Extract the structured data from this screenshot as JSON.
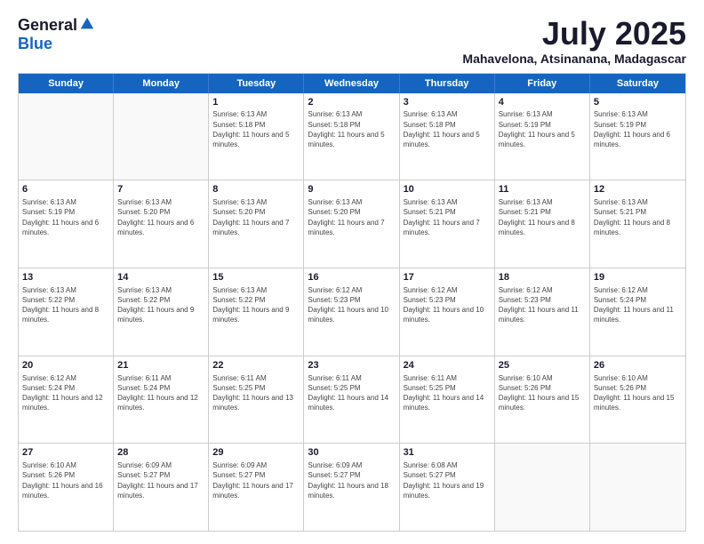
{
  "logo": {
    "general": "General",
    "blue": "Blue"
  },
  "title": "July 2025",
  "subtitle": "Mahavelona, Atsinanana, Madagascar",
  "headers": [
    "Sunday",
    "Monday",
    "Tuesday",
    "Wednesday",
    "Thursday",
    "Friday",
    "Saturday"
  ],
  "weeks": [
    [
      {
        "day": "",
        "info": ""
      },
      {
        "day": "",
        "info": ""
      },
      {
        "day": "1",
        "info": "Sunrise: 6:13 AM\nSunset: 5:18 PM\nDaylight: 11 hours and 5 minutes."
      },
      {
        "day": "2",
        "info": "Sunrise: 6:13 AM\nSunset: 5:18 PM\nDaylight: 11 hours and 5 minutes."
      },
      {
        "day": "3",
        "info": "Sunrise: 6:13 AM\nSunset: 5:18 PM\nDaylight: 11 hours and 5 minutes."
      },
      {
        "day": "4",
        "info": "Sunrise: 6:13 AM\nSunset: 5:19 PM\nDaylight: 11 hours and 5 minutes."
      },
      {
        "day": "5",
        "info": "Sunrise: 6:13 AM\nSunset: 5:19 PM\nDaylight: 11 hours and 6 minutes."
      }
    ],
    [
      {
        "day": "6",
        "info": "Sunrise: 6:13 AM\nSunset: 5:19 PM\nDaylight: 11 hours and 6 minutes."
      },
      {
        "day": "7",
        "info": "Sunrise: 6:13 AM\nSunset: 5:20 PM\nDaylight: 11 hours and 6 minutes."
      },
      {
        "day": "8",
        "info": "Sunrise: 6:13 AM\nSunset: 5:20 PM\nDaylight: 11 hours and 7 minutes."
      },
      {
        "day": "9",
        "info": "Sunrise: 6:13 AM\nSunset: 5:20 PM\nDaylight: 11 hours and 7 minutes."
      },
      {
        "day": "10",
        "info": "Sunrise: 6:13 AM\nSunset: 5:21 PM\nDaylight: 11 hours and 7 minutes."
      },
      {
        "day": "11",
        "info": "Sunrise: 6:13 AM\nSunset: 5:21 PM\nDaylight: 11 hours and 8 minutes."
      },
      {
        "day": "12",
        "info": "Sunrise: 6:13 AM\nSunset: 5:21 PM\nDaylight: 11 hours and 8 minutes."
      }
    ],
    [
      {
        "day": "13",
        "info": "Sunrise: 6:13 AM\nSunset: 5:22 PM\nDaylight: 11 hours and 8 minutes."
      },
      {
        "day": "14",
        "info": "Sunrise: 6:13 AM\nSunset: 5:22 PM\nDaylight: 11 hours and 9 minutes."
      },
      {
        "day": "15",
        "info": "Sunrise: 6:13 AM\nSunset: 5:22 PM\nDaylight: 11 hours and 9 minutes."
      },
      {
        "day": "16",
        "info": "Sunrise: 6:12 AM\nSunset: 5:23 PM\nDaylight: 11 hours and 10 minutes."
      },
      {
        "day": "17",
        "info": "Sunrise: 6:12 AM\nSunset: 5:23 PM\nDaylight: 11 hours and 10 minutes."
      },
      {
        "day": "18",
        "info": "Sunrise: 6:12 AM\nSunset: 5:23 PM\nDaylight: 11 hours and 11 minutes."
      },
      {
        "day": "19",
        "info": "Sunrise: 6:12 AM\nSunset: 5:24 PM\nDaylight: 11 hours and 11 minutes."
      }
    ],
    [
      {
        "day": "20",
        "info": "Sunrise: 6:12 AM\nSunset: 5:24 PM\nDaylight: 11 hours and 12 minutes."
      },
      {
        "day": "21",
        "info": "Sunrise: 6:11 AM\nSunset: 5:24 PM\nDaylight: 11 hours and 12 minutes."
      },
      {
        "day": "22",
        "info": "Sunrise: 6:11 AM\nSunset: 5:25 PM\nDaylight: 11 hours and 13 minutes."
      },
      {
        "day": "23",
        "info": "Sunrise: 6:11 AM\nSunset: 5:25 PM\nDaylight: 11 hours and 14 minutes."
      },
      {
        "day": "24",
        "info": "Sunrise: 6:11 AM\nSunset: 5:25 PM\nDaylight: 11 hours and 14 minutes."
      },
      {
        "day": "25",
        "info": "Sunrise: 6:10 AM\nSunset: 5:26 PM\nDaylight: 11 hours and 15 minutes."
      },
      {
        "day": "26",
        "info": "Sunrise: 6:10 AM\nSunset: 5:26 PM\nDaylight: 11 hours and 15 minutes."
      }
    ],
    [
      {
        "day": "27",
        "info": "Sunrise: 6:10 AM\nSunset: 5:26 PM\nDaylight: 11 hours and 16 minutes."
      },
      {
        "day": "28",
        "info": "Sunrise: 6:09 AM\nSunset: 5:27 PM\nDaylight: 11 hours and 17 minutes."
      },
      {
        "day": "29",
        "info": "Sunrise: 6:09 AM\nSunset: 5:27 PM\nDaylight: 11 hours and 17 minutes."
      },
      {
        "day": "30",
        "info": "Sunrise: 6:09 AM\nSunset: 5:27 PM\nDaylight: 11 hours and 18 minutes."
      },
      {
        "day": "31",
        "info": "Sunrise: 6:08 AM\nSunset: 5:27 PM\nDaylight: 11 hours and 19 minutes."
      },
      {
        "day": "",
        "info": ""
      },
      {
        "day": "",
        "info": ""
      }
    ]
  ]
}
